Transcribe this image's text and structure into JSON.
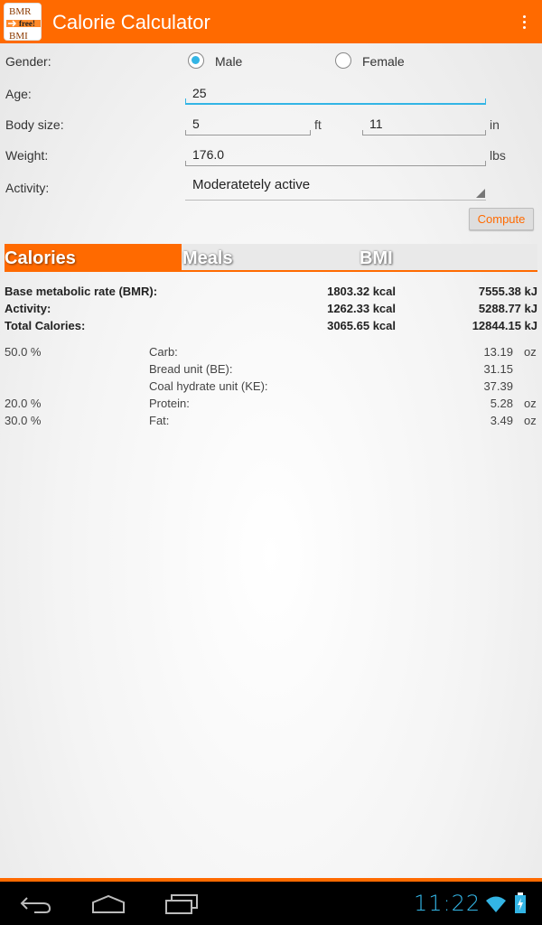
{
  "app": {
    "title": "Calorie Calculator",
    "icon_name": "bmr-bmi-app-icon",
    "icon_text": [
      "BMR",
      "free!",
      "BMI"
    ]
  },
  "colors": {
    "accent": "#ff6a00",
    "focus": "#33b5e5"
  },
  "form": {
    "gender": {
      "label": "Gender:",
      "options": [
        "Male",
        "Female"
      ],
      "selected": "Male"
    },
    "age": {
      "label": "Age:",
      "value": "25"
    },
    "body_size": {
      "label": "Body size:",
      "feet": "5",
      "feet_unit": "ft",
      "inches": "11",
      "inches_unit": "in"
    },
    "weight": {
      "label": "Weight:",
      "value": "176.0",
      "unit": "lbs"
    },
    "activity": {
      "label": "Activity:",
      "value": "Moderatetely active"
    },
    "compute_label": "Compute"
  },
  "tabs": [
    {
      "label": "Calories",
      "active": true
    },
    {
      "label": "Meals",
      "active": false
    },
    {
      "label": "BMI",
      "active": false
    }
  ],
  "results": {
    "bmr": {
      "label": "Base metabolic rate (BMR):",
      "kcal": "1803.32 kcal",
      "kj": "7555.38 kJ"
    },
    "activity": {
      "label": "Activity:",
      "kcal": "1262.33 kcal",
      "kj": "5288.77 kJ"
    },
    "total": {
      "label": "Total Calories:",
      "kcal": "3065.65 kcal",
      "kj": "12844.15 kJ"
    }
  },
  "nutrients": [
    {
      "percent": "50.0 %",
      "name": "Carb:",
      "value": "13.19",
      "unit": "oz"
    },
    {
      "percent": "",
      "name": "Bread unit (BE):",
      "value": "31.15",
      "unit": ""
    },
    {
      "percent": "",
      "name": "Coal hydrate unit (KE):",
      "value": "37.39",
      "unit": ""
    },
    {
      "percent": "20.0 %",
      "name": "Protein:",
      "value": "5.28",
      "unit": "oz"
    },
    {
      "percent": "30.0 %",
      "name": "Fat:",
      "value": "3.49",
      "unit": "oz"
    }
  ],
  "system": {
    "time": "11:22"
  }
}
